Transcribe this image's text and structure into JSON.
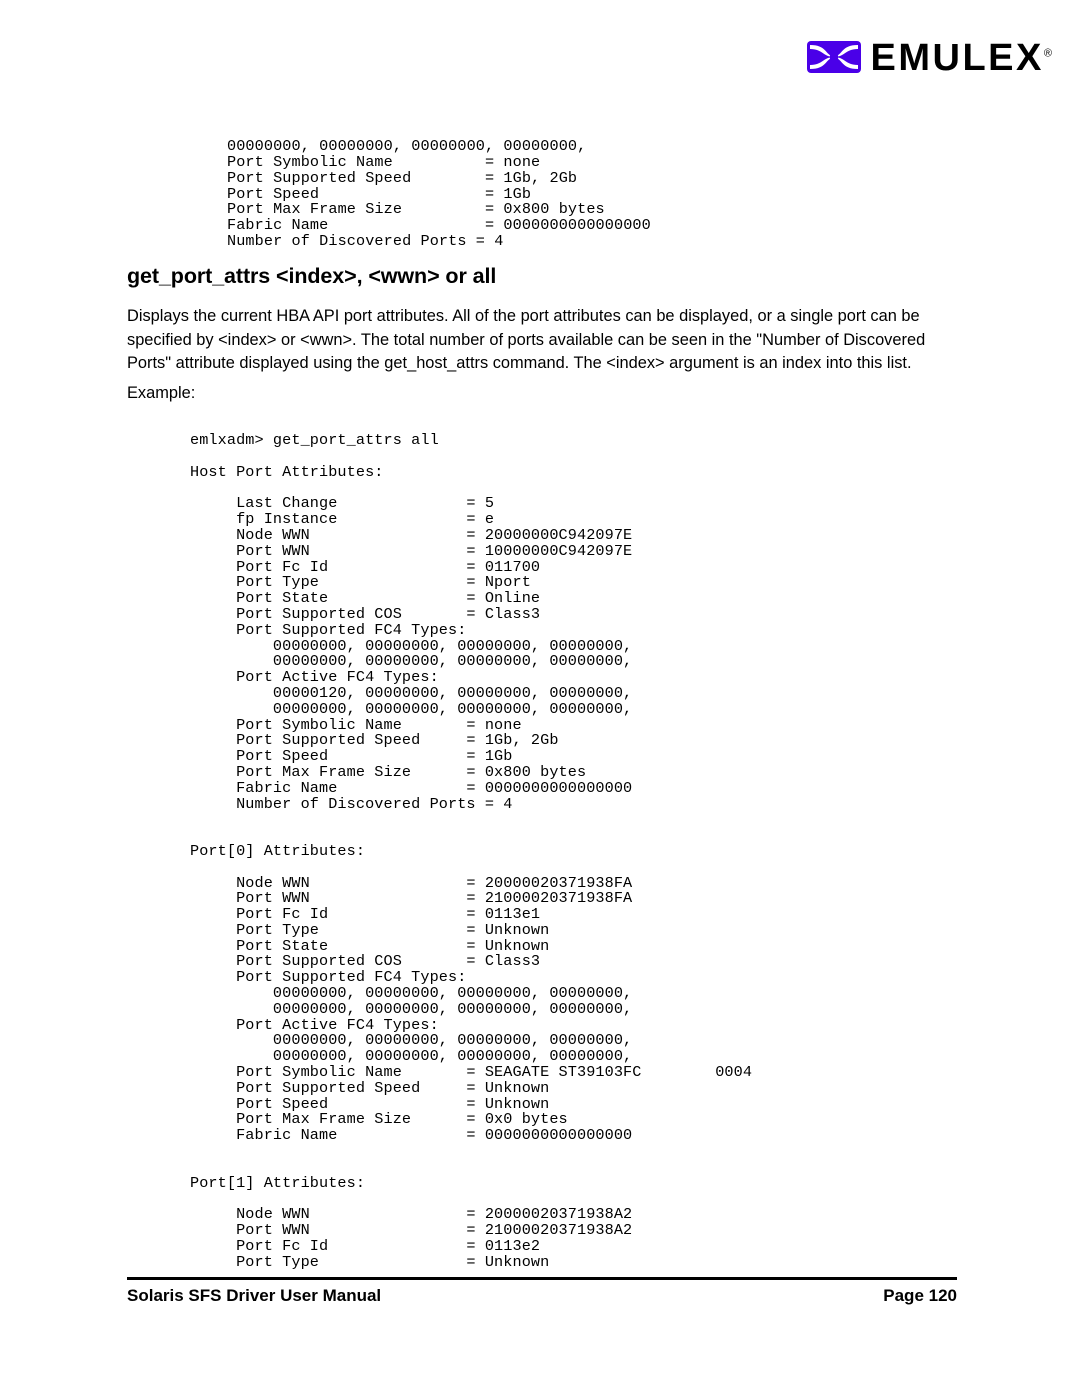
{
  "brand": {
    "name": "EMULEX",
    "trademark": "®",
    "mark_color": "#4a00e8",
    "text_color": "#000000"
  },
  "top_console": {
    "lines": "00000000, 00000000, 00000000, 00000000,\nPort Symbolic Name          = none\nPort Supported Speed        = 1Gb, 2Gb\nPort Speed                  = 1Gb\nPort Max Frame Size         = 0x800 bytes\nFabric Name                 = 0000000000000000\nNumber of Discovered Ports = 4"
  },
  "section": {
    "heading": "get_port_attrs <index>, <wwn> or all",
    "paragraph": "Displays the current HBA API port attributes. All of the port attributes can be displayed, or a single port can be specified by <index> or <wwn>. The total number of ports available can be seen in the \"Number of Discovered Ports\" attribute displayed using the get_host_attrs command. The <index> argument is an index into this list.",
    "example_label": "Example:"
  },
  "main_console": {
    "lines": "emlxadm> get_port_attrs all\n\nHost Port Attributes:\n\n     Last Change              = 5\n     fp Instance              = e\n     Node WWN                 = 20000000C942097E\n     Port WWN                 = 10000000C942097E\n     Port Fc Id               = 011700\n     Port Type                = Nport\n     Port State               = Online\n     Port Supported COS       = Class3\n     Port Supported FC4 Types:\n         00000000, 00000000, 00000000, 00000000,\n         00000000, 00000000, 00000000, 00000000,\n     Port Active FC4 Types:\n         00000120, 00000000, 00000000, 00000000,\n         00000000, 00000000, 00000000, 00000000,\n     Port Symbolic Name       = none\n     Port Supported Speed     = 1Gb, 2Gb\n     Port Speed               = 1Gb\n     Port Max Frame Size      = 0x800 bytes\n     Fabric Name              = 0000000000000000\n     Number of Discovered Ports = 4\n\n\nPort[0] Attributes:\n\n     Node WWN                 = 20000020371938FA\n     Port WWN                 = 21000020371938FA\n     Port Fc Id               = 0113e1\n     Port Type                = Unknown\n     Port State               = Unknown\n     Port Supported COS       = Class3\n     Port Supported FC4 Types:\n         00000000, 00000000, 00000000, 00000000,\n         00000000, 00000000, 00000000, 00000000,\n     Port Active FC4 Types:\n         00000000, 00000000, 00000000, 00000000,\n         00000000, 00000000, 00000000, 00000000,\n     Port Symbolic Name       = SEAGATE ST39103FC        0004\n     Port Supported Speed     = Unknown\n     Port Speed               = Unknown\n     Port Max Frame Size      = 0x0 bytes\n     Fabric Name              = 0000000000000000\n\n\nPort[1] Attributes:\n\n     Node WWN                 = 20000020371938A2\n     Port WWN                 = 21000020371938A2\n     Port Fc Id               = 0113e2\n     Port Type                = Unknown"
  },
  "footer": {
    "manual_title": "Solaris SFS Driver User Manual",
    "page_label": "Page 120"
  }
}
